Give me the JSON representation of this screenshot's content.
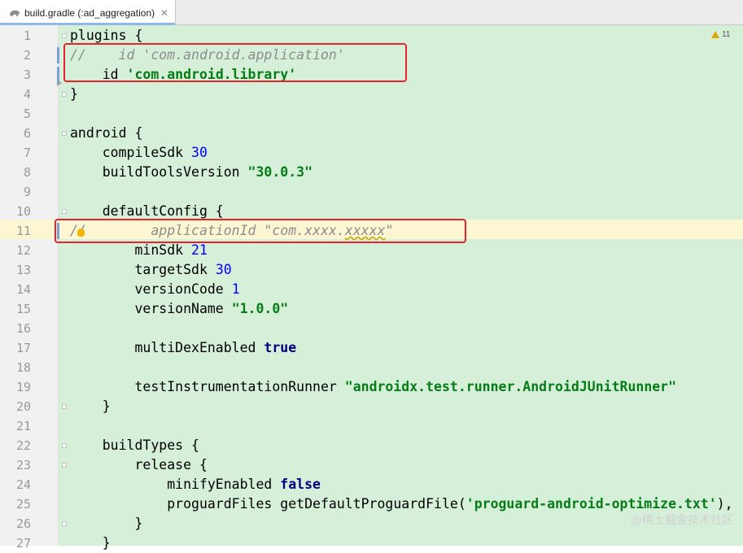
{
  "tab": {
    "title": "build.gradle (:ad_aggregation)",
    "close": "✕"
  },
  "inspection": {
    "warning_count": "11"
  },
  "watermark": "@稀土掘金技术社区",
  "lines": [
    {
      "n": "1",
      "code": "plugins {"
    },
    {
      "n": "2",
      "code": "//    id 'com.android.application'"
    },
    {
      "n": "3",
      "code": "    id 'com.android.library'"
    },
    {
      "n": "4",
      "code": "}"
    },
    {
      "n": "5",
      "code": ""
    },
    {
      "n": "6",
      "code": "android {"
    },
    {
      "n": "7",
      "code": "    compileSdk 30"
    },
    {
      "n": "8",
      "code": "    buildToolsVersion \"30.0.3\""
    },
    {
      "n": "9",
      "code": ""
    },
    {
      "n": "10",
      "code": "    defaultConfig {"
    },
    {
      "n": "11",
      "code": "//        applicationId \"com.xxxx.xxxxx\""
    },
    {
      "n": "12",
      "code": "        minSdk 21"
    },
    {
      "n": "13",
      "code": "        targetSdk 30"
    },
    {
      "n": "14",
      "code": "        versionCode 1"
    },
    {
      "n": "15",
      "code": "        versionName \"1.0.0\""
    },
    {
      "n": "16",
      "code": ""
    },
    {
      "n": "17",
      "code": "        multiDexEnabled true"
    },
    {
      "n": "18",
      "code": ""
    },
    {
      "n": "19",
      "code": "        testInstrumentationRunner \"androidx.test.runner.AndroidJUnitRunner\""
    },
    {
      "n": "20",
      "code": "    }"
    },
    {
      "n": "21",
      "code": ""
    },
    {
      "n": "22",
      "code": "    buildTypes {"
    },
    {
      "n": "23",
      "code": "        release {"
    },
    {
      "n": "24",
      "code": "            minifyEnabled false"
    },
    {
      "n": "25",
      "code": "            proguardFiles getDefaultProguardFile('proguard-android-optimize.txt'),"
    },
    {
      "n": "26",
      "code": "        }"
    },
    {
      "n": "27",
      "code": "    }"
    }
  ]
}
